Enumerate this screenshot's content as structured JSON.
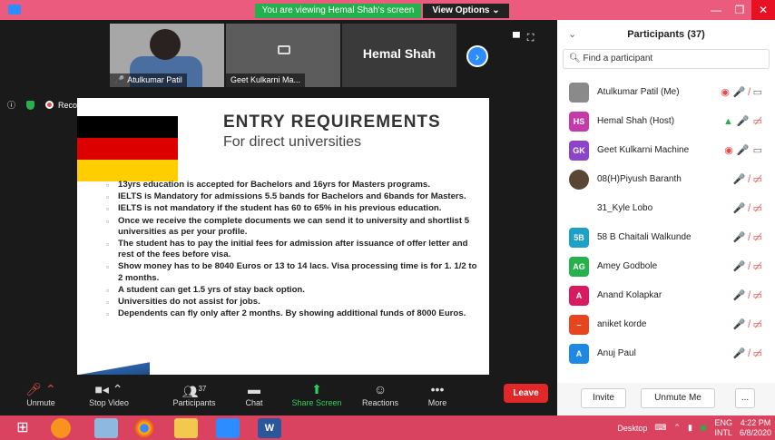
{
  "titlebar": {
    "viewing_text": "You are viewing Hemal Shah's screen",
    "view_options": "View Options ⌄",
    "min": "—",
    "max": "❐",
    "close": "✕"
  },
  "thumbnails": [
    {
      "name": "Atulkumar Patil"
    },
    {
      "name": "Geet Kulkarni Ma..."
    },
    {
      "name": "Hemal Shah"
    }
  ],
  "recording": {
    "label": "Recording...",
    "pause": "❚❚",
    "stop": "■"
  },
  "slide": {
    "title": "ENTRY REQUIREMENTS",
    "subtitle": "For direct universities",
    "bullets": [
      "13yrs education is accepted for Bachelors and 16yrs for Masters  programs.",
      "IELTS is Mandatory for admissions 5.5 bands for Bachelors and 6bands  for Masters.",
      "IELTS is not mandatory if the student has 60 to 65% in his previous education.",
      "Once we receive the complete documents we can send it to university  and shortlist 5 universities as per your profile.",
      "The student has to pay the initial fees for admission after issuance of  offer letter and rest of the fees before visa.",
      "Show money has to be 8040 Euros or 13 to 14 lacs.  Visa processing time is for 1. 1/2 to 2 months.",
      "A student can get 1.5 yrs of stay back option.",
      "Universities do not assist for jobs.",
      "Dependents can fly only after 2 months. By showing additional funds of  8000 Euros."
    ],
    "flag_colors": [
      "#000000",
      "#dd0000",
      "#ffce00"
    ]
  },
  "panel": {
    "title": "Participants (37)",
    "search_placeholder": "Find a participant",
    "participants": [
      {
        "name": "Atulkumar Patil (Me)",
        "initials": "",
        "color": "#8a8a8a",
        "icons": "◉ 🎤̸ ▭"
      },
      {
        "name": "Hemal Shah (Host)",
        "initials": "HS",
        "color": "#c43aa8",
        "icons": "▲ 🎤 ▭̸"
      },
      {
        "name": "Geet Kulkarni Machine",
        "initials": "GK",
        "color": "#8e44c9",
        "icons": "◉ 🎤 ▭"
      },
      {
        "name": "08(H)Piyush Baranth",
        "initials": "",
        "color": "#5a4634",
        "icons": "🎤̸ ▭̸"
      },
      {
        "name": "31_Kyle Lobo",
        "initials": "",
        "color": "#ffffff",
        "icons": "🎤̸ ▭̸"
      },
      {
        "name": "58 B Chaitali Walkunde",
        "initials": "5B",
        "color": "#1da1c9",
        "icons": "🎤̸ ▭̸"
      },
      {
        "name": "Amey Godbole",
        "initials": "AG",
        "color": "#27b14c",
        "icons": "🎤̸ ▭̸"
      },
      {
        "name": "Anand Kolapkar",
        "initials": "A",
        "color": "#d81b60",
        "icons": "🎤̸ ▭̸"
      },
      {
        "name": "aniket korde",
        "initials": "–",
        "color": "#e8451e",
        "icons": "🎤̸ ▭̸"
      },
      {
        "name": "Anuj Paul",
        "initials": "A",
        "color": "#1e88e5",
        "icons": "🎤̸ ▭̸"
      }
    ],
    "invite": "Invite",
    "unmute_me": "Unmute Me",
    "more": "..."
  },
  "toolbar": {
    "unmute": "Unmute",
    "stop_video": "Stop Video",
    "participants": "Participants",
    "participants_count": "37",
    "chat": "Chat",
    "share_screen": "Share Screen",
    "reactions": "Reactions",
    "more": "More",
    "leave": "Leave"
  },
  "taskbar": {
    "desktop": "Desktop",
    "lang_top": "ENG",
    "lang_bottom": "INTL",
    "time": "4:22 PM",
    "date": "6/8/2020"
  }
}
